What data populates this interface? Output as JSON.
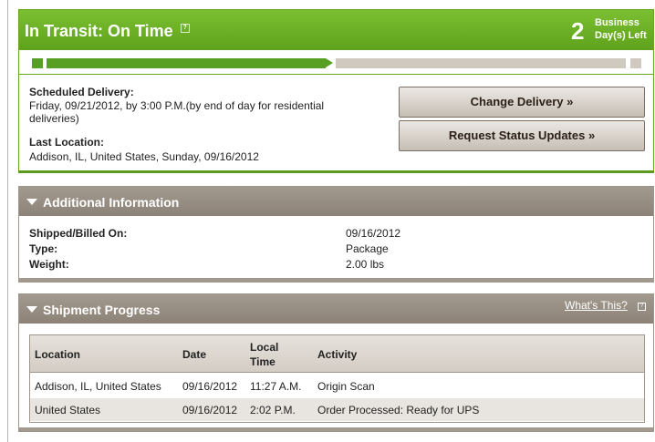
{
  "transit": {
    "title": "In Transit: On Time",
    "days_count": "2",
    "days_label_line1": "Business",
    "days_label_line2": "Day(s) Left",
    "progress_fraction": 0.5,
    "scheduled_label": "Scheduled Delivery:",
    "scheduled_value": "Friday, 09/21/2012, by 3:00 P.M.(by end of day for residential deliveries)",
    "last_location_label": "Last Location:",
    "last_location_value": "Addison, IL, United States, Sunday, 09/16/2012",
    "change_button": "Change Delivery »",
    "request_button": "Request Status Updates »"
  },
  "additional": {
    "title": "Additional Information",
    "rows": [
      {
        "label": "Shipped/Billed On:",
        "value": "09/16/2012"
      },
      {
        "label": "Type:",
        "value": "Package"
      },
      {
        "label": "Weight:",
        "value": "2.00 lbs"
      }
    ]
  },
  "shipment_progress": {
    "title": "Shipment Progress",
    "whats_this": "What's This?",
    "columns": {
      "location": "Location",
      "date": "Date",
      "local_time_1": "Local",
      "local_time_2": "Time",
      "activity": "Activity"
    },
    "rows": [
      {
        "location": "Addison, IL, United States",
        "date": "09/16/2012",
        "time": "11:27 A.M.",
        "activity": "Origin Scan"
      },
      {
        "location": "United States",
        "date": "09/16/2012",
        "time": "2:02 P.M.",
        "activity": "Order Processed: Ready for UPS"
      }
    ]
  },
  "colors": {
    "accent_green": "#6aa624",
    "section_taupe": "#9e958b"
  }
}
